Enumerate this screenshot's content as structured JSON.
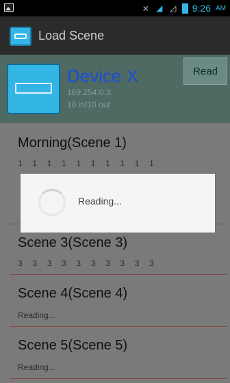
{
  "status": {
    "time": "9:26",
    "ampm": "AM",
    "icons": [
      "image-icon",
      "mute-icon",
      "wifi-icon",
      "signal-icon",
      "battery-icon"
    ]
  },
  "actionbar": {
    "title": "Load Scene"
  },
  "device": {
    "name": "Device X",
    "ip": "169.254.0.3",
    "io": "10 in/10 out",
    "read_label": "Read"
  },
  "scenes": [
    {
      "title": "Morning(Scene 1)",
      "sub_numbers": [
        "1",
        "1",
        "1",
        "1",
        "1",
        "1",
        "1",
        "1",
        "1",
        "1"
      ]
    },
    {
      "title": "Scene 3(Scene 3)",
      "sub_numbers": [
        "3",
        "3",
        "3",
        "3",
        "3",
        "3",
        "3",
        "3",
        "3",
        "3"
      ]
    },
    {
      "title": "Scene 4(Scene 4)",
      "sub_text": "Reading..."
    },
    {
      "title": "Scene 5(Scene 5)",
      "sub_text": "Reading..."
    }
  ],
  "dialog": {
    "text": "Reading..."
  }
}
